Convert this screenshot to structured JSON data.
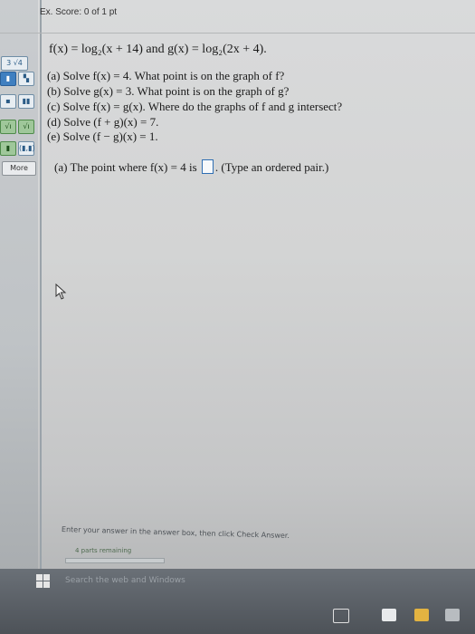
{
  "header": {
    "score_label": "Ex. Score:",
    "score_value": "0 of 1 pt"
  },
  "toolbar": {
    "top_button": "3 √4",
    "buttons": [
      [
        "▮",
        "▚"
      ],
      [
        "▪",
        "▮▮"
      ],
      [
        "√ı",
        "√ı"
      ],
      [
        "▮",
        "(▮,▮)"
      ]
    ],
    "more_label": "More"
  },
  "problem": {
    "equation": "f(x) = log₂(x + 14) and g(x) = log₂(2x + 4).",
    "parts": [
      "(a) Solve f(x) = 4. What point is on the graph of f?",
      "(b) Solve g(x) = 3. What point is on the graph of g?",
      "(c) Solve f(x) = g(x). Where do the graphs of f and g intersect?",
      "(d) Solve (f + g)(x) = 7.",
      "(e) Solve (f − g)(x) = 1."
    ]
  },
  "prompt": {
    "before": "(a) The point where f(x) = 4 is",
    "after": ". (Type an ordered pair.)"
  },
  "footer": {
    "instruction": "Enter your answer in the answer box, then click Check Answer.",
    "parts_remaining": "4 parts remaining",
    "progress": 0.0
  },
  "taskbar": {
    "search_placeholder": "Search the web and Windows"
  },
  "colors": {
    "accent": "#2f6fb3",
    "progress_fill": "#7cb342"
  }
}
